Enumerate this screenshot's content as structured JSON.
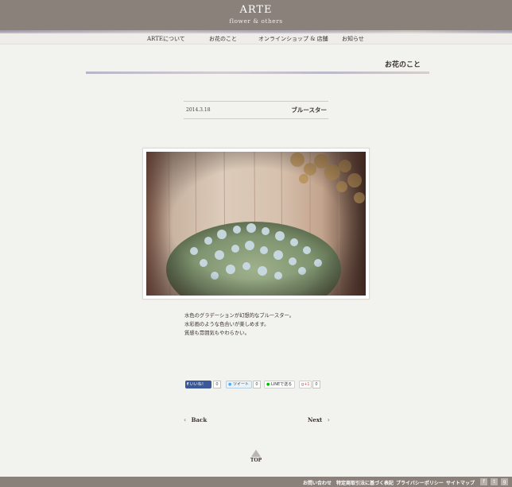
{
  "header": {
    "logo": "ARTE",
    "tagline": "flower & others"
  },
  "nav": {
    "items": [
      {
        "label": "ARTEについて"
      },
      {
        "label": "お花のこと"
      },
      {
        "label": "オンラインショップ & 店舗"
      },
      {
        "label": "お知らせ"
      }
    ]
  },
  "section": {
    "title": "お花のこと"
  },
  "post": {
    "date": "2014.3.18",
    "title": "ブルースター",
    "body": [
      "水色のグラデーションが幻想的なブルースター。",
      "水彩画のような色合いが楽しめます。",
      "質感も雰囲気もやわらかい。"
    ]
  },
  "share": {
    "facebook_label": "いいね！",
    "facebook_count": "0",
    "tweet_label": "ツイート",
    "tweet_count": "0",
    "line_label": "LINEで送る",
    "gplus_label": "+1",
    "gplus_count": "0"
  },
  "pager": {
    "prev": "Back",
    "next": "Next"
  },
  "to_top": "TOP",
  "footer": {
    "links": [
      {
        "label": "お問い合わせ"
      },
      {
        "label": "特定商取引法に基づく表記"
      },
      {
        "label": "プライバシーポリシー"
      },
      {
        "label": "サイトマップ"
      }
    ],
    "social": [
      "facebook-icon",
      "twitter-icon",
      "google-plus-icon"
    ]
  },
  "colors": {
    "header": "#8b817b",
    "background": "#f2f2ee",
    "facebook": "#3b5998",
    "twitter": "#55acee",
    "line": "#00b900",
    "gplus": "#dd4b39"
  }
}
